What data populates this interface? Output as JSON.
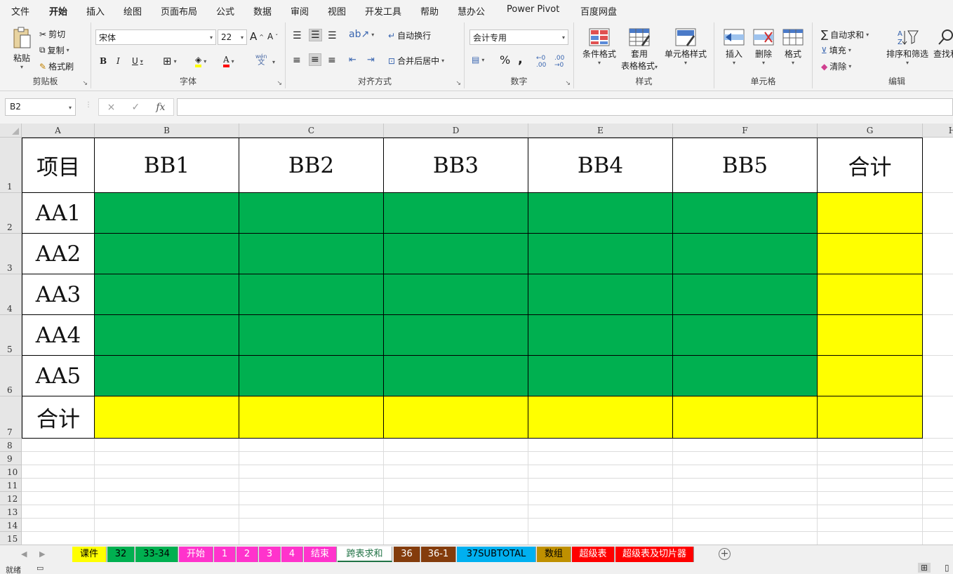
{
  "ribbon_tabs": [
    "文件",
    "开始",
    "插入",
    "绘图",
    "页面布局",
    "公式",
    "数据",
    "审阅",
    "视图",
    "开发工具",
    "帮助",
    "慧办公",
    "Power Pivot",
    "百度网盘"
  ],
  "active_tab": "开始",
  "clipboard": {
    "paste": "粘贴",
    "cut": "剪切",
    "copy": "复制",
    "format_painter": "格式刷",
    "label": "剪贴板"
  },
  "font": {
    "name": "宋体",
    "size": "22",
    "bold": "B",
    "italic": "I",
    "underline": "U",
    "grow": "A",
    "shrink": "A",
    "font_color_glyph": "A",
    "phonetic_top": "wén",
    "phonetic_bottom": "文",
    "label": "字体",
    "fill_color": "#ffff00",
    "text_color": "#ff0000"
  },
  "alignment": {
    "wrap": "自动换行",
    "merge": "合并后居中",
    "label": "对齐方式"
  },
  "number": {
    "format": "会计专用",
    "percent": "%",
    "comma": ",",
    "label": "数字"
  },
  "styles": {
    "conditional": "条件格式",
    "table_format_1": "套用",
    "table_format_2": "表格格式",
    "cell_styles": "单元格样式",
    "label": "样式"
  },
  "cells": {
    "insert": "插入",
    "delete": "删除",
    "format": "格式",
    "label": "单元格"
  },
  "editing": {
    "autosum": "自动求和",
    "fill": "填充",
    "clear": "清除",
    "sort": "排序和筛选",
    "find": "查找和",
    "label": "编辑",
    "autosum_icon": "∑"
  },
  "formula_bar": {
    "name_box": "B2",
    "cancel": "×",
    "enter": "✓",
    "fx": "fx",
    "value": ""
  },
  "columns": [
    "A",
    "B",
    "C",
    "D",
    "E",
    "F",
    "G",
    "H"
  ],
  "rows": [
    "1",
    "2",
    "3",
    "4",
    "5",
    "6",
    "7",
    "8",
    "9",
    "10",
    "11",
    "12",
    "13",
    "14",
    "15"
  ],
  "table": {
    "corner": "项目",
    "headers": [
      "BB1",
      "BB2",
      "BB3",
      "BB4",
      "BB5",
      "合计"
    ],
    "row_labels": [
      "AA1",
      "AA2",
      "AA3",
      "AA4",
      "AA5",
      "合计"
    ],
    "colors": {
      "data": "#00b050",
      "total": "#ffff00"
    }
  },
  "sheet_tabs": [
    {
      "name": "课件",
      "color": "#ffff00",
      "text": "#000000"
    },
    {
      "name": "32",
      "color": "#00b050",
      "text": "#000000"
    },
    {
      "name": "33-34",
      "color": "#00b050",
      "text": "#000000"
    },
    {
      "name": "开始",
      "color": "#ff33cc",
      "text": "#ffffff"
    },
    {
      "name": "1",
      "color": "#ff33cc",
      "text": "#ffffff"
    },
    {
      "name": "2",
      "color": "#ff33cc",
      "text": "#ffffff"
    },
    {
      "name": "3",
      "color": "#ff33cc",
      "text": "#ffffff"
    },
    {
      "name": "4",
      "color": "#ff33cc",
      "text": "#ffffff"
    },
    {
      "name": "结束",
      "color": "#ff33cc",
      "text": "#ffffff"
    },
    {
      "name": "跨表求和",
      "color": "#ffffff",
      "text": "#217346",
      "active": true
    },
    {
      "name": "36",
      "color": "#843c0c",
      "text": "#ffffff"
    },
    {
      "name": "36-1",
      "color": "#843c0c",
      "text": "#ffffff"
    },
    {
      "name": "37SUBTOTAL",
      "color": "#00b0f0",
      "text": "#000000"
    },
    {
      "name": "数组",
      "color": "#bf9000",
      "text": "#000000"
    },
    {
      "name": "超级表",
      "color": "#ff0000",
      "text": "#ffffff"
    },
    {
      "name": "超级表及切片器",
      "color": "#ff0000",
      "text": "#ffffff"
    }
  ],
  "add_sheet": "+",
  "status": {
    "ready": "就绪"
  }
}
